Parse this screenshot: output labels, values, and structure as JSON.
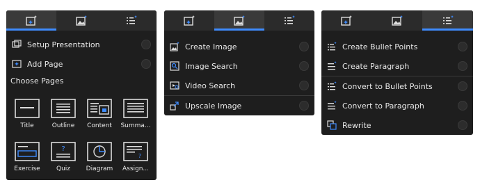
{
  "colors": {
    "accent": "#3f8cff",
    "panel_bg": "#1e1e1e",
    "tab_bg": "#2b2b2b",
    "text": "#e8e8e8"
  },
  "panel1": {
    "tabs": [
      {
        "icon": "image-sparkle-icon",
        "active": true
      },
      {
        "icon": "image-mountain-sparkle-icon",
        "active": false
      },
      {
        "icon": "list-sparkle-icon",
        "active": false
      }
    ],
    "items": [
      {
        "label": "Setup Presentation",
        "icon": "presentation-icon"
      },
      {
        "label": "Add Page",
        "icon": "add-page-icon"
      }
    ],
    "section_title": "Choose Pages",
    "pages": [
      {
        "label": "Title",
        "icon": "title-layout-icon"
      },
      {
        "label": "Outline",
        "icon": "outline-layout-icon"
      },
      {
        "label": "Content",
        "icon": "content-layout-icon"
      },
      {
        "label": "Summa...",
        "icon": "summary-layout-icon"
      },
      {
        "label": "Exercise",
        "icon": "exercise-layout-icon"
      },
      {
        "label": "Quiz",
        "icon": "quiz-layout-icon"
      },
      {
        "label": "Diagram",
        "icon": "diagram-layout-icon"
      },
      {
        "label": "Assign...",
        "icon": "assignment-layout-icon"
      }
    ]
  },
  "panel2": {
    "items": [
      {
        "label": "Create Image",
        "icon": "create-image-icon"
      },
      {
        "label": "Image Search",
        "icon": "image-search-icon"
      },
      {
        "label": "Video Search",
        "icon": "video-search-icon"
      },
      {
        "label": "Upscale Image",
        "icon": "upscale-image-icon"
      }
    ]
  },
  "panel3": {
    "items": [
      {
        "label": "Create Bullet Points",
        "icon": "create-bullets-icon"
      },
      {
        "label": "Create Paragraph",
        "icon": "create-paragraph-icon"
      },
      {
        "label": "Convert to Bullet Points",
        "icon": "convert-bullets-icon"
      },
      {
        "label": "Convert to Paragraph",
        "icon": "convert-paragraph-icon"
      },
      {
        "label": "Rewrite",
        "icon": "rewrite-icon"
      }
    ]
  }
}
